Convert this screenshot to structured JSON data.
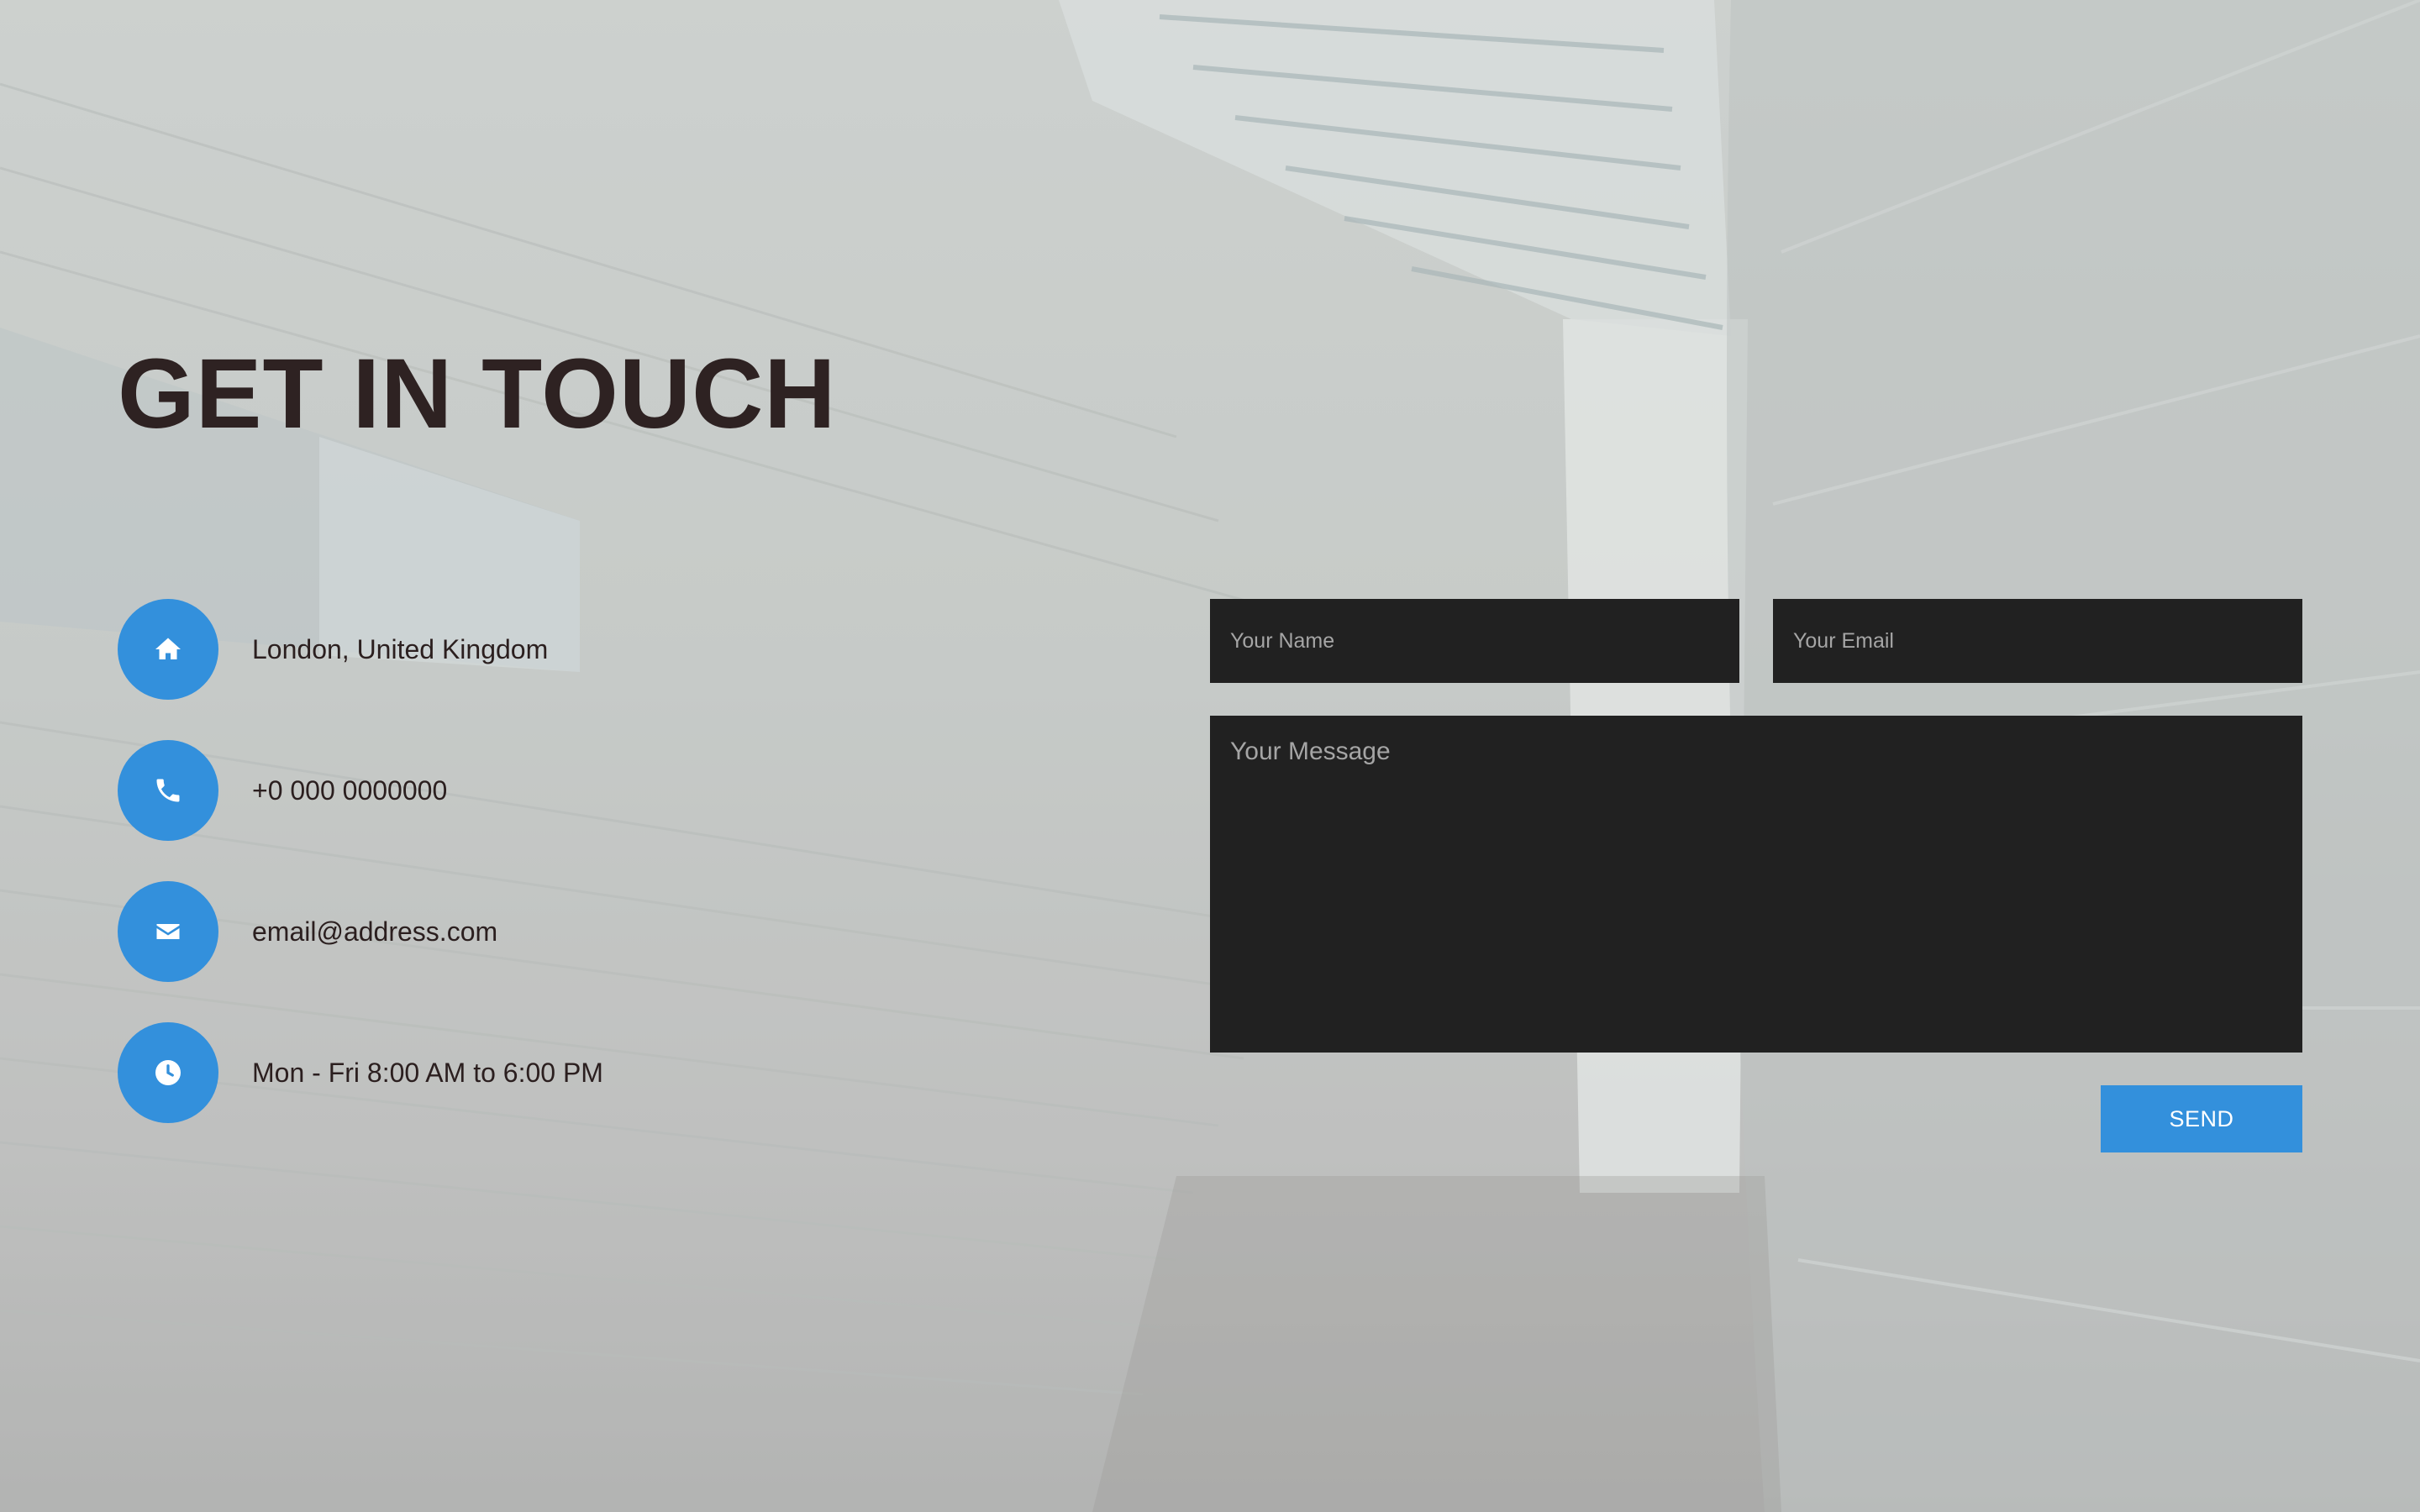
{
  "page": {
    "title": "GET IN TOUCH"
  },
  "contact": {
    "items": [
      {
        "icon": "home-icon",
        "text": "London, United Kingdom"
      },
      {
        "icon": "phone-icon",
        "text": "+0 000 0000000"
      },
      {
        "icon": "envelope-icon",
        "text": "email@address.com"
      },
      {
        "icon": "clock-icon",
        "text": "Mon - Fri 8:00 AM to 6:00 PM"
      }
    ]
  },
  "form": {
    "name_placeholder": "Your Name",
    "name_value": "",
    "email_placeholder": "Your Email",
    "email_value": "",
    "message_placeholder": "Your Message",
    "message_value": "",
    "send_label": "SEND"
  },
  "colors": {
    "accent": "#3390dc",
    "field_background": "#212121",
    "title": "#2e2222",
    "text": "#2b1f1f"
  }
}
